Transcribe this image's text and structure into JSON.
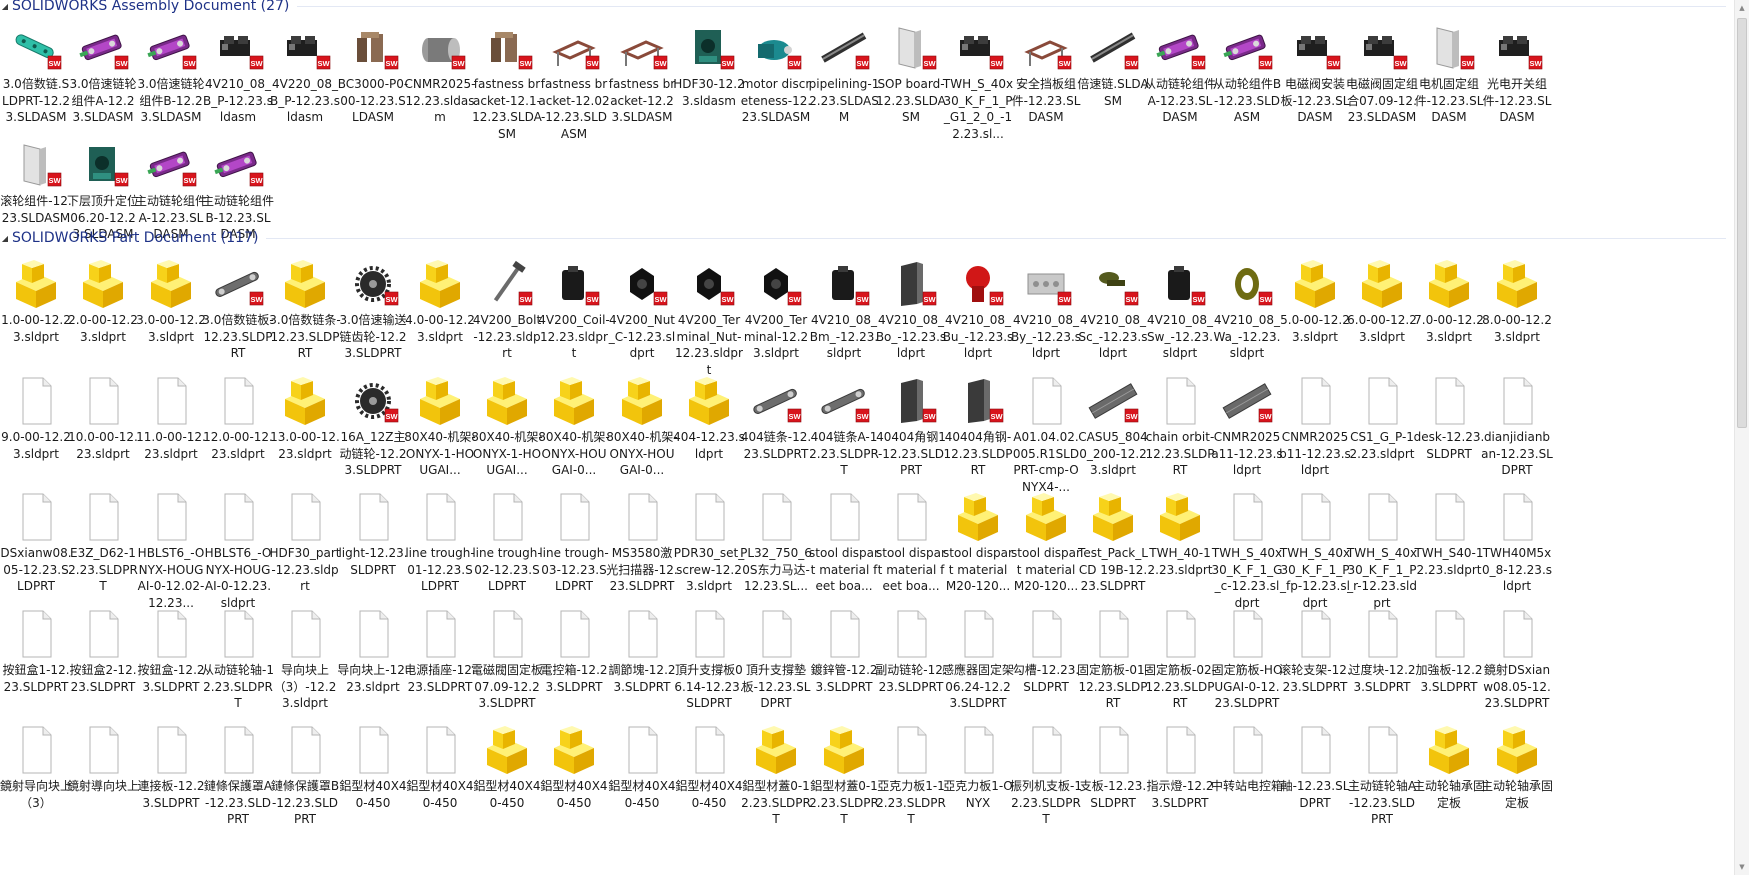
{
  "groups": [
    {
      "title": "SOLIDWORKS Assembly Document (27)",
      "items": [
        {
          "name": "3.0倍数链.SLDPRT-12.23.SLDASM",
          "icon": "chain-icon"
        },
        {
          "name": "3.0倍速链轮组件A-12.23.SLDASM",
          "icon": "sprocket-assembly-icon"
        },
        {
          "name": "3.0倍速链轮组件B-12.23.SLDASM",
          "icon": "sprocket-assembly-icon"
        },
        {
          "name": "4V210_08_B_P-12.23.sldasm",
          "icon": "valve-icon"
        },
        {
          "name": "4V220_08_B_P-12.23.sldasm",
          "icon": "valve-icon"
        },
        {
          "name": "BC3000-P0-00-12.23.SLDASM",
          "icon": "bracket-assembly-icon"
        },
        {
          "name": "CNMR2025-12.23.sldasm",
          "icon": "cylinder-icon"
        },
        {
          "name": "fastness bracket-12.1-12.23.SLDASM",
          "icon": "bracket-assembly-icon"
        },
        {
          "name": "fastness bracket-12.02-12.23.SLDASM",
          "icon": "frame-assembly-icon"
        },
        {
          "name": "fastness bracket-12.23.SLDASM",
          "icon": "frame-assembly-icon"
        },
        {
          "name": "HDF30-12.23.sldasm",
          "icon": "module-icon"
        },
        {
          "name": "motor discreteness-12.23.SLDASM",
          "icon": "motor-icon"
        },
        {
          "name": "pipelining-12.23.SLDASM",
          "icon": "rail-icon"
        },
        {
          "name": "SOP board-12.23.SLDASM",
          "icon": "board-icon"
        },
        {
          "name": "TWH_S_40x30_K_F_1_P_G1_2_0_-12.23.sl...",
          "icon": "valve-icon"
        },
        {
          "name": "安全挡板组件-12.23.SLDASM",
          "icon": "frame-assembly-icon"
        },
        {
          "name": "倍速链.SLDASM",
          "icon": "rail-icon"
        },
        {
          "name": "从动链轮组件A-12.23.SLDASM",
          "icon": "sprocket-assembly-icon"
        },
        {
          "name": "从动轮组件B-12.23.SLDASM",
          "icon": "sprocket-assembly-icon"
        },
        {
          "name": "电磁阀安装板-12.23.SLDASM",
          "icon": "valve-icon"
        },
        {
          "name": "电磁阀固定组合07.09-12.23.SLDASM",
          "icon": "valve-icon"
        },
        {
          "name": "电机固定组件-12.23.SLDASM",
          "icon": "board-icon"
        },
        {
          "name": "光电开关组件-12.23.SLDASM",
          "icon": "valve-icon"
        },
        {
          "name": "滚轮组件-12.23.SLDASM",
          "icon": "board-icon"
        },
        {
          "name": "下层顶升定位06.20-12.23.SLDASM",
          "icon": "module-icon"
        },
        {
          "name": "主动链轮组件A-12.23.SLDASM",
          "icon": "sprocket-assembly-icon"
        },
        {
          "name": "主动链轮组件B-12.23.SLDASM",
          "icon": "sprocket-assembly-icon"
        }
      ]
    },
    {
      "title": "SOLIDWORKS Part Document (117)",
      "items": [
        {
          "name": "1.0-00-12.23.sldprt",
          "icon": "block-icon"
        },
        {
          "name": "2.0-00-12.23.sldprt",
          "icon": "block-icon"
        },
        {
          "name": "3.0-00-12.23.sldprt",
          "icon": "block-icon"
        },
        {
          "name": "3.0倍数链板-12.23.SLDPRT",
          "icon": "link-plate-icon"
        },
        {
          "name": "3.0倍数链条-12.23.SLDPRT",
          "icon": "block-icon"
        },
        {
          "name": "3.0倍速输送链齿轮-12.23.SLDPRT",
          "icon": "gear-icon"
        },
        {
          "name": "4.0-00-12.23.sldprt",
          "icon": "block-icon"
        },
        {
          "name": "4V200_Bolt-12.23.sldprt",
          "icon": "bolt-icon"
        },
        {
          "name": "4V200_Coil-12.23.sldprt",
          "icon": "coil-icon"
        },
        {
          "name": "4V200_Nut_C-12.23.sldprt",
          "icon": "nut-icon"
        },
        {
          "name": "4V200_Terminal_Nut-12.23.sldprt",
          "icon": "nut-icon"
        },
        {
          "name": "4V200_Terminal-12.23.sldprt",
          "icon": "nut-icon"
        },
        {
          "name": "4V210_08_Bm_-12.23.sldprt",
          "icon": "coil-icon"
        },
        {
          "name": "4V210_08_Bo_-12.23.sldprt",
          "icon": "plate-icon"
        },
        {
          "name": "4V210_08_Bu_-12.23.sldprt",
          "icon": "button-part-icon"
        },
        {
          "name": "4V210_08_By_-12.23.sldprt",
          "icon": "housing-icon"
        },
        {
          "name": "4V210_08_Sc_-12.23.sldprt",
          "icon": "screw-icon"
        },
        {
          "name": "4V210_08_Sw_-12.23.sldprt",
          "icon": "coil-icon"
        },
        {
          "name": "4V210_08_Wa_-12.23.sldprt",
          "icon": "washer-icon"
        },
        {
          "name": "5.0-00-12.23.sldprt",
          "icon": "block-icon"
        },
        {
          "name": "6.0-00-12.23.sldprt",
          "icon": "block-icon"
        },
        {
          "name": "7.0-00-12.23.sldprt",
          "icon": "block-icon"
        },
        {
          "name": "8.0-00-12.23.sldprt",
          "icon": "block-icon"
        },
        {
          "name": "9.0-00-12.23.sldprt",
          "icon": "blank-file-icon"
        },
        {
          "name": "10.0-00-12.23.sldprt",
          "icon": "blank-file-icon"
        },
        {
          "name": "11.0-00-12.23.sldprt",
          "icon": "blank-file-icon"
        },
        {
          "name": "12.0-00-12.23.sldprt",
          "icon": "blank-file-icon"
        },
        {
          "name": "13.0-00-12.23.sldprt",
          "icon": "block-icon"
        },
        {
          "name": "16A_12Z主动链轮-12.23.SLDPRT",
          "icon": "gear-icon"
        },
        {
          "name": "80X40-机架-ONYX-1-HOUGAI...",
          "icon": "block-icon"
        },
        {
          "name": "80X40-机架-ONYX-1-HOUGAI...",
          "icon": "block-icon"
        },
        {
          "name": "80X40-机架-ONYX-HOUGAI-0...",
          "icon": "block-icon"
        },
        {
          "name": "80X40-机架-ONYX-HOUGAI-0...",
          "icon": "block-icon"
        },
        {
          "name": "404-12.23.sldprt",
          "icon": "block-icon"
        },
        {
          "name": "404链条-12.23.SLDPRT",
          "icon": "link-plate-icon"
        },
        {
          "name": "404链条A-12.23.SLDPRT",
          "icon": "link-plate-icon"
        },
        {
          "name": "40404角钢1-12.23.SLDPRT",
          "icon": "plate-icon"
        },
        {
          "name": "40404角钢-12.23.SLDPRT",
          "icon": "plate-icon"
        },
        {
          "name": "A01.04.02.005.R1SLDPRT-cmp-ONYX4-...",
          "icon": "blank-file-icon"
        },
        {
          "name": "CASU5_8040_200-12.23.sldprt",
          "icon": "profile-icon"
        },
        {
          "name": "chain orbit-12.23.SLDPRT",
          "icon": "blank-file-icon"
        },
        {
          "name": "CNMR2025a11-12.23.sldprt",
          "icon": "profile-icon"
        },
        {
          "name": "CNMR2025b11-12.23.sldprt",
          "icon": "blank-file-icon"
        },
        {
          "name": "CS1_G_P-12.23.sldprt",
          "icon": "blank-file-icon"
        },
        {
          "name": "desk-12.23.SLDPRT",
          "icon": "blank-file-icon"
        },
        {
          "name": "dianjidianban-12.23.SLDPRT",
          "icon": "blank-file-icon"
        },
        {
          "name": "DSxianw08.05-12.23.SLDPRT",
          "icon": "blank-file-icon"
        },
        {
          "name": "E3Z_D62-12.23.SLDPRT",
          "icon": "blank-file-icon"
        },
        {
          "name": "HBLST6_-ONYX-HOUGAI-0-12.02-12.23...",
          "icon": "blank-file-icon"
        },
        {
          "name": "HBLST6_-ONYX-HOUGAI-0-12.23.sldprt",
          "icon": "blank-file-icon"
        },
        {
          "name": "HDF30_part-12.23.sldprt",
          "icon": "blank-file-icon"
        },
        {
          "name": "light-12.23.SLDPRT",
          "icon": "blank-file-icon"
        },
        {
          "name": "line trough-01-12.23.SLDPRT",
          "icon": "blank-file-icon"
        },
        {
          "name": "line trough-02-12.23.SLDPRT",
          "icon": "blank-file-icon"
        },
        {
          "name": "line trough-03-12.23.SLDPRT",
          "icon": "blank-file-icon"
        },
        {
          "name": "MS3580激光扫描器-12.23.SLDPRT",
          "icon": "blank-file-icon"
        },
        {
          "name": "PDR30_set_screw-12.23.sldprt",
          "icon": "blank-file-icon"
        },
        {
          "name": "PL32_750_60S东力马达-12.23.SL...",
          "icon": "blank-file-icon"
        },
        {
          "name": "stool dispart material feet boa...",
          "icon": "blank-file-icon"
        },
        {
          "name": "stool dispart material feet boa...",
          "icon": "blank-file-icon"
        },
        {
          "name": "stool dispart material M20-120...",
          "icon": "block-icon"
        },
        {
          "name": "stool dispart material M20-120...",
          "icon": "block-icon"
        },
        {
          "name": "Test_Pack_LCD 19B-12.23.SLDPRT",
          "icon": "block-icon"
        },
        {
          "name": "TWH_40-12.23.sldprt",
          "icon": "block-icon"
        },
        {
          "name": "TWH_S_40x30_K_F_1_G_c-12.23.sldprt",
          "icon": "blank-file-icon"
        },
        {
          "name": "TWH_S_40x30_K_F_1_P_fp-12.23.sldprt",
          "icon": "blank-file-icon"
        },
        {
          "name": "TWH_S_40x30_K_F_1_P_r-12.23.sldprt",
          "icon": "blank-file-icon"
        },
        {
          "name": "TWH_S40-12.23.sldprt",
          "icon": "blank-file-icon"
        },
        {
          "name": "TWH40M5x0_8-12.23.sldprt",
          "icon": "blank-file-icon"
        },
        {
          "name": "按鈕盒1-12.23.SLDPRT",
          "icon": "blank-file-icon"
        },
        {
          "name": "按鈕盒2-12.23.SLDPRT",
          "icon": "blank-file-icon"
        },
        {
          "name": "按鈕盒-12.23.SLDPRT",
          "icon": "blank-file-icon"
        },
        {
          "name": "从动链轮轴-12.23.SLDPRT",
          "icon": "blank-file-icon"
        },
        {
          "name": "导向块上（3）-12.23.sldprt",
          "icon": "blank-file-icon"
        },
        {
          "name": "导向块上-12.23.sldprt",
          "icon": "blank-file-icon"
        },
        {
          "name": "电源插座-12.23.SLDPRT",
          "icon": "blank-file-icon"
        },
        {
          "name": "電磁閥固定板07.09-12.23.SLDPRT",
          "icon": "blank-file-icon"
        },
        {
          "name": "電控箱-12.23.SLDPRT",
          "icon": "blank-file-icon"
        },
        {
          "name": "調節塊-12.23.SLDPRT",
          "icon": "blank-file-icon"
        },
        {
          "name": "頂升支撐板06.14-12.23.SLDPRT",
          "icon": "blank-file-icon"
        },
        {
          "name": "頂升支撐墊板-12.23.SLDPRT",
          "icon": "blank-file-icon"
        },
        {
          "name": "鍍鋅管-12.23.SLDPRT",
          "icon": "blank-file-icon"
        },
        {
          "name": "副动链轮-12.23.SLDPRT",
          "icon": "blank-file-icon"
        },
        {
          "name": "感應器固定架06.24-12.23.SLDPRT",
          "icon": "blank-file-icon"
        },
        {
          "name": "勾槽-12.23.SLDPRT",
          "icon": "blank-file-icon"
        },
        {
          "name": "固定筋板-01-12.23.SLDPRT",
          "icon": "blank-file-icon"
        },
        {
          "name": "固定筋板-02-12.23.SLDPRT",
          "icon": "blank-file-icon"
        },
        {
          "name": "固定筋板-HOUGAI-0-12.23.SLDPRT",
          "icon": "blank-file-icon"
        },
        {
          "name": "滚轮支架-12.23.SLDPRT",
          "icon": "blank-file-icon"
        },
        {
          "name": "过度块-12.23.SLDPRT",
          "icon": "blank-file-icon"
        },
        {
          "name": "加強板-12.23.SLDPRT",
          "icon": "blank-file-icon"
        },
        {
          "name": "鏡射DSxianw08.05-12.23.SLDPRT",
          "icon": "blank-file-icon"
        },
        {
          "name": "鏡射导向块上（3）",
          "icon": "blank-file-icon"
        },
        {
          "name": "鏡射導向块上",
          "icon": "blank-file-icon"
        },
        {
          "name": "連接板-12.23.SLDPRT",
          "icon": "blank-file-icon"
        },
        {
          "name": "鏈條保護罩A-12.23.SLDPRT",
          "icon": "blank-file-icon"
        },
        {
          "name": "鏈條保護罩B-12.23.SLDPRT",
          "icon": "blank-file-icon"
        },
        {
          "name": "鋁型材40X40-450",
          "icon": "blank-file-icon"
        },
        {
          "name": "鋁型材40X40-450",
          "icon": "blank-file-icon"
        },
        {
          "name": "鋁型材40X40-450",
          "icon": "block-icon"
        },
        {
          "name": "鋁型材40X40-450",
          "icon": "block-icon"
        },
        {
          "name": "鋁型材40X40-450",
          "icon": "blank-file-icon"
        },
        {
          "name": "鋁型材40X40-450",
          "icon": "blank-file-icon"
        },
        {
          "name": "鋁型材蓋0-12.23.SLDPRT",
          "icon": "block-icon"
        },
        {
          "name": "鋁型材蓋0-12.23.SLDPRT",
          "icon": "block-icon"
        },
        {
          "name": "亞克力板1-12.23.SLDPRT",
          "icon": "blank-file-icon"
        },
        {
          "name": "亞克力板1-ONYX",
          "icon": "blank-file-icon"
        },
        {
          "name": "振列机支板-12.23.SLDPRT",
          "icon": "blank-file-icon"
        },
        {
          "name": "支板-12.23.SLDPRT",
          "icon": "blank-file-icon"
        },
        {
          "name": "指示燈-12.23.SLDPRT",
          "icon": "blank-file-icon"
        },
        {
          "name": "中转站电控箱",
          "icon": "blank-file-icon"
        },
        {
          "name": "軸-12.23.SLDPRT",
          "icon": "blank-file-icon"
        },
        {
          "name": "主动链轮轴A-12.23.SLDPRT",
          "icon": "blank-file-icon"
        },
        {
          "name": "主动轮轴承固定板",
          "icon": "block-icon"
        },
        {
          "name": "主动轮轴承固定板",
          "icon": "block-icon"
        }
      ]
    }
  ]
}
